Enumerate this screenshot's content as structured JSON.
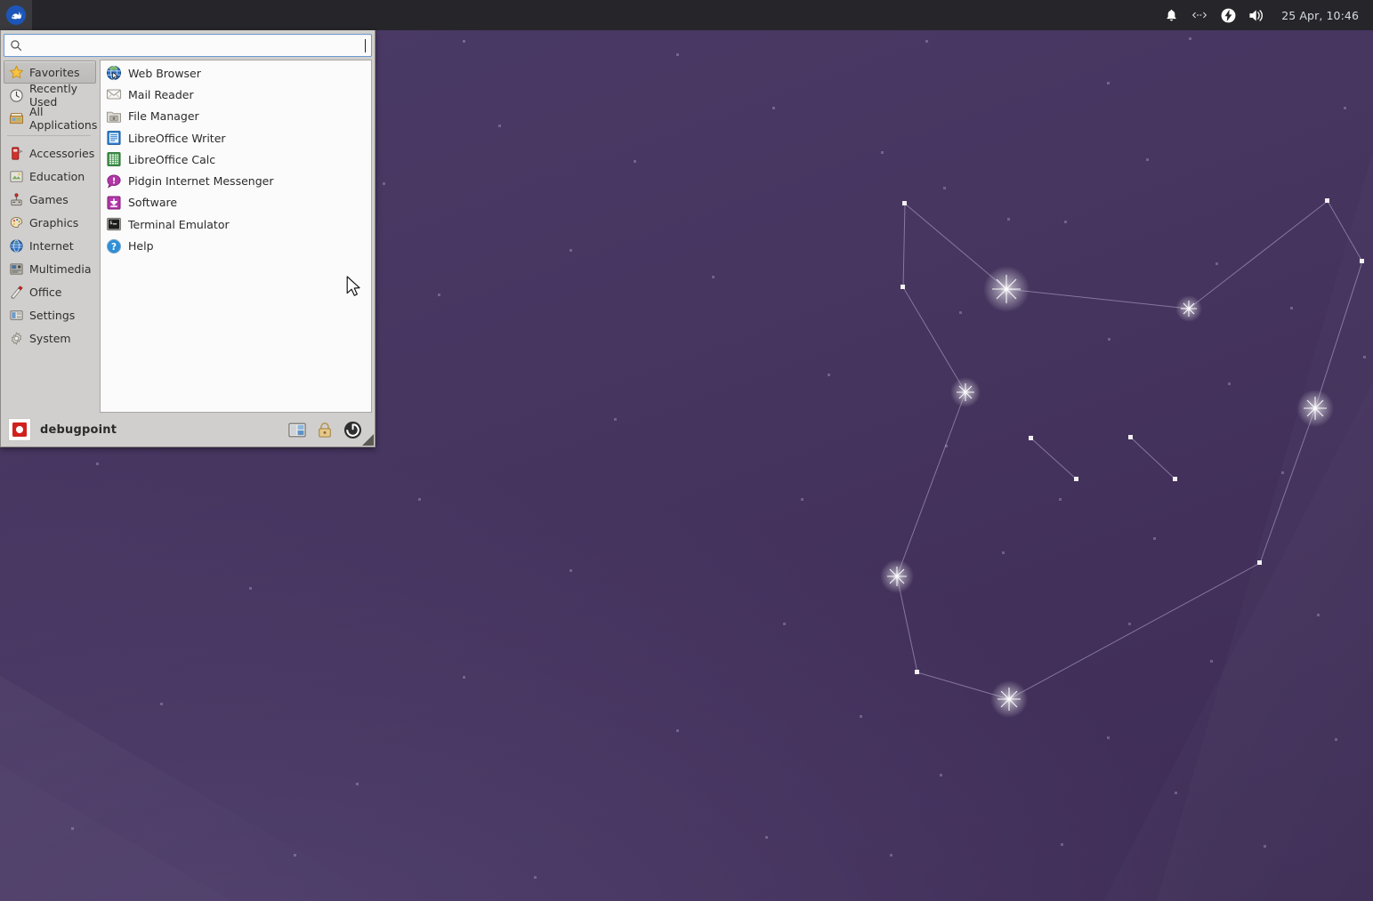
{
  "panel": {
    "menu_button": {
      "icon": "whisker-mouse-icon",
      "tooltip": "Applications"
    },
    "tray": [
      {
        "name": "notification-bell-icon",
        "glyph": "bell"
      },
      {
        "name": "workspace-switch-icon",
        "glyph": "arrows"
      },
      {
        "name": "power-manager-icon",
        "glyph": "bolt"
      },
      {
        "name": "volume-icon",
        "glyph": "speaker"
      }
    ],
    "clock": "25 Apr, 10:46"
  },
  "menu": {
    "search": {
      "value": "",
      "placeholder": "",
      "icon": "search-icon"
    },
    "categories": [
      {
        "label": "Favorites",
        "icon": "star-icon",
        "selected": true
      },
      {
        "label": "Recently Used",
        "icon": "clock-icon",
        "selected": false
      },
      {
        "label": "All Applications",
        "icon": "drawer-icon",
        "selected": false
      },
      {
        "separator": true
      },
      {
        "label": "Accessories",
        "icon": "accessories-icon",
        "selected": false
      },
      {
        "label": "Education",
        "icon": "education-icon",
        "selected": false
      },
      {
        "label": "Games",
        "icon": "games-icon",
        "selected": false
      },
      {
        "label": "Graphics",
        "icon": "graphics-icon",
        "selected": false
      },
      {
        "label": "Internet",
        "icon": "globe-icon",
        "selected": false
      },
      {
        "label": "Multimedia",
        "icon": "multimedia-icon",
        "selected": false
      },
      {
        "label": "Office",
        "icon": "office-icon",
        "selected": false
      },
      {
        "label": "Settings",
        "icon": "settings-icon",
        "selected": false
      },
      {
        "label": "System",
        "icon": "system-gear-icon",
        "selected": false
      }
    ],
    "applications": [
      {
        "label": "Web Browser",
        "icon": "web-browser-icon"
      },
      {
        "label": "Mail Reader",
        "icon": "mail-reader-icon"
      },
      {
        "label": "File Manager",
        "icon": "file-manager-icon"
      },
      {
        "label": "LibreOffice Writer",
        "icon": "libreoffice-writer-icon"
      },
      {
        "label": "LibreOffice Calc",
        "icon": "libreoffice-calc-icon"
      },
      {
        "label": "Pidgin Internet Messenger",
        "icon": "pidgin-icon"
      },
      {
        "label": "Software",
        "icon": "software-icon"
      },
      {
        "label": "Terminal Emulator",
        "icon": "terminal-icon"
      },
      {
        "label": "Help",
        "icon": "help-icon"
      }
    ],
    "footer": {
      "username": "debugpoint",
      "avatar": "user-avatar",
      "actions": [
        {
          "name": "switch-user-button",
          "icon": "switch-user-icon"
        },
        {
          "name": "lock-screen-button",
          "icon": "lock-icon"
        },
        {
          "name": "log-out-button",
          "icon": "power-icon"
        }
      ]
    }
  },
  "desktop": {
    "wallpaper": "constellation-wallpaper",
    "colors": {
      "bg_top": "#4a3a66",
      "bg_bottom": "#3e2d56",
      "panel": "#26262a",
      "accent": "#6b9ad1"
    }
  }
}
